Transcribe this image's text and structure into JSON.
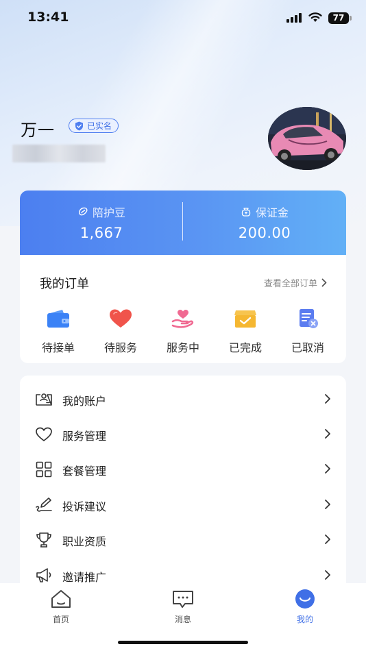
{
  "status_bar": {
    "time": "13:41",
    "battery": "77"
  },
  "profile": {
    "name": "万一",
    "verified_label": "已实名"
  },
  "balance": {
    "beans": {
      "label": "陪护豆",
      "value": "1,667"
    },
    "deposit": {
      "label": "保证金",
      "value": "200.00"
    }
  },
  "orders": {
    "title": "我的订单",
    "view_all": "查看全部订单",
    "items": [
      {
        "label": "待接单",
        "icon": "wallet-icon",
        "color": "#3b82f6"
      },
      {
        "label": "待服务",
        "icon": "heart-icon",
        "color": "#f0544b"
      },
      {
        "label": "服务中",
        "icon": "hand-heart-icon",
        "color": "#f06a92"
      },
      {
        "label": "已完成",
        "icon": "box-check-icon",
        "color": "#f5b731"
      },
      {
        "label": "已取消",
        "icon": "doc-cancel-icon",
        "color": "#5b7cf0"
      }
    ]
  },
  "menu": [
    {
      "label": "我的账户",
      "icon": "account-card-icon"
    },
    {
      "label": "服务管理",
      "icon": "heart-outline-icon"
    },
    {
      "label": "套餐管理",
      "icon": "grid-icon"
    },
    {
      "label": "投诉建议",
      "icon": "pen-feedback-icon"
    },
    {
      "label": "职业资质",
      "icon": "trophy-icon"
    },
    {
      "label": "邀请推广",
      "icon": "megaphone-icon"
    }
  ],
  "tabs": [
    {
      "label": "首页",
      "icon": "home-icon",
      "active": false
    },
    {
      "label": "消息",
      "icon": "message-icon",
      "active": false
    },
    {
      "label": "我的",
      "icon": "profile-smile-icon",
      "active": true
    }
  ],
  "colors": {
    "accent": "#3f6fe6",
    "card_gradient_start": "#4c7ff0",
    "card_gradient_end": "#62b0f6"
  }
}
